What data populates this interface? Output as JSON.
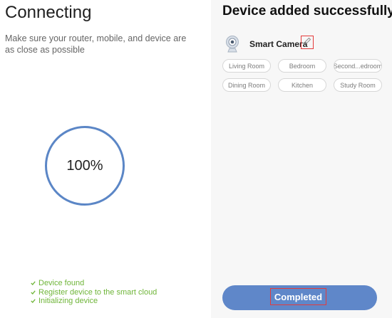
{
  "connecting_screen": {
    "title": "Connecting",
    "subtitle": "Make sure your router, mobile, and device are as close as possible",
    "progress": {
      "value": 1,
      "label": "100%"
    },
    "status_items": [
      {
        "label": "Device found",
        "done": true
      },
      {
        "label": "Register device to the smart cloud",
        "done": true
      },
      {
        "label": "Initializing device",
        "done": true
      }
    ]
  },
  "success_screen": {
    "title": "Device added successfully",
    "device": {
      "name": "Smart Camera",
      "icon": "camera-icon",
      "edit_icon": "pencil-icon"
    },
    "rooms": [
      "Living Room",
      "Bedroom",
      "Second...edroom",
      "Dining Room",
      "Kitchen",
      "Study Room"
    ],
    "button_label": "Completed"
  },
  "colors": {
    "accent": "#5f87c9",
    "ring": "#5b86c6",
    "status": "#6fb539",
    "highlight": "#e43b3b",
    "chip_border": "#d7d7d7"
  }
}
